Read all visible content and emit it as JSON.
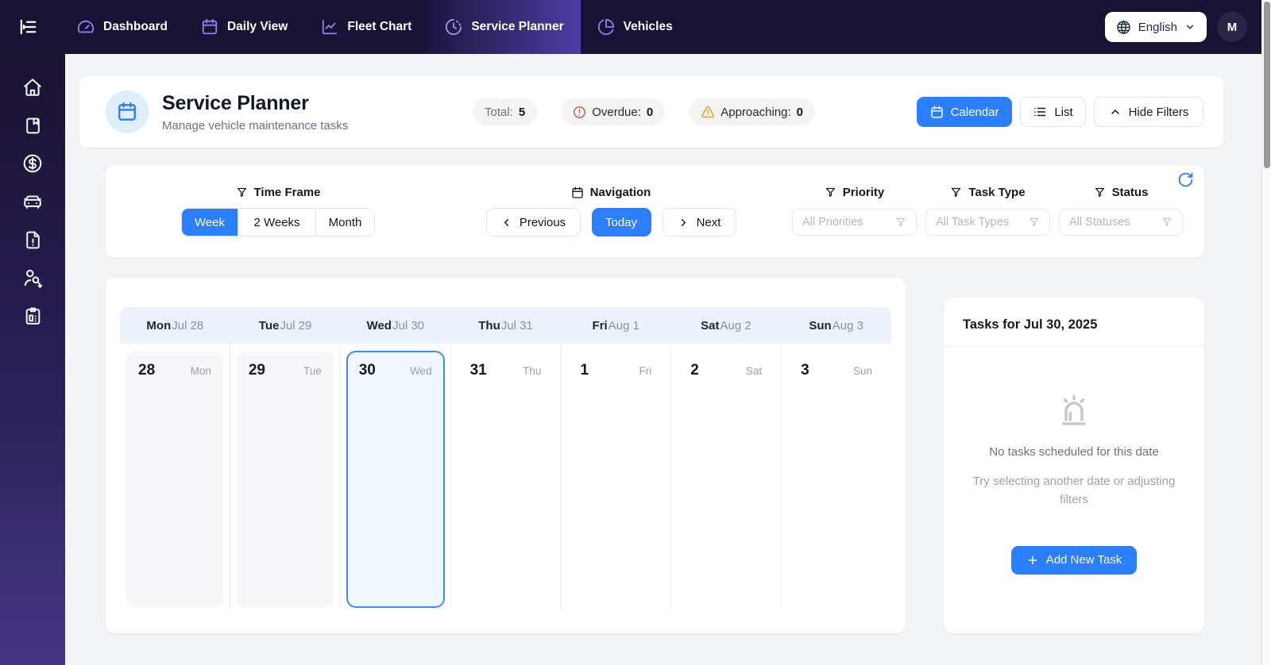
{
  "navbar": {
    "items": [
      {
        "label": "Dashboard",
        "icon": "gauge-icon",
        "active": false
      },
      {
        "label": "Daily View",
        "icon": "calendar-icon",
        "active": false
      },
      {
        "label": "Fleet Chart",
        "icon": "line-chart-icon",
        "active": false
      },
      {
        "label": "Service Planner",
        "icon": "clock-fading-icon",
        "active": true
      },
      {
        "label": "Vehicles",
        "icon": "pie-chart-icon",
        "active": false
      }
    ],
    "language": {
      "label": "English",
      "icon": "globe-icon"
    },
    "avatar": "M"
  },
  "sidebar": {
    "icons": [
      "home-icon",
      "bookmark-icon",
      "dollar-circle-icon",
      "car-icon",
      "file-alert-icon",
      "user-search-icon",
      "clipboard-icon"
    ]
  },
  "header": {
    "title": "Service Planner",
    "subtitle": "Manage vehicle maintenance tasks",
    "stats": [
      {
        "label": "Total:",
        "value": "5"
      },
      {
        "label": "Overdue:",
        "value": "0",
        "icon": "alert-circle-icon"
      },
      {
        "label": "Approaching:",
        "value": "0",
        "icon": "warning-triangle-icon"
      }
    ],
    "buttons": {
      "calendar": "Calendar",
      "list": "List",
      "hide_filters": "Hide Filters"
    }
  },
  "filters": {
    "time_frame": {
      "label": "Time Frame",
      "options": [
        "Week",
        "2 Weeks",
        "Month"
      ],
      "selected": "Week"
    },
    "navigation": {
      "label": "Navigation",
      "previous": "Previous",
      "today": "Today",
      "next": "Next"
    },
    "priority": {
      "label": "Priority",
      "placeholder": "All Priorities"
    },
    "task_type": {
      "label": "Task Type",
      "placeholder": "All Task Types"
    },
    "status": {
      "label": "Status",
      "placeholder": "All Statuses"
    }
  },
  "calendar": {
    "days": [
      {
        "name": "Mon",
        "date": "Jul 28",
        "num": "28",
        "state": "past"
      },
      {
        "name": "Tue",
        "date": "Jul 29",
        "num": "29",
        "state": "past"
      },
      {
        "name": "Wed",
        "date": "Jul 30",
        "num": "30",
        "state": "selected"
      },
      {
        "name": "Thu",
        "date": "Jul 31",
        "num": "31",
        "state": "future"
      },
      {
        "name": "Fri",
        "date": "Aug 1",
        "num": "1",
        "state": "future"
      },
      {
        "name": "Sat",
        "date": "Aug 2",
        "num": "2",
        "state": "future"
      },
      {
        "name": "Sun",
        "date": "Aug 3",
        "num": "3",
        "state": "future"
      }
    ],
    "selected_index": 2
  },
  "tasks_panel": {
    "title": "Tasks for Jul 30, 2025",
    "empty_title": "No tasks scheduled for this date",
    "empty_hint": "Try selecting another date or adjusting filters",
    "add_button": "Add New Task"
  },
  "colors": {
    "accent_blue": "#2b7fff",
    "danger_red": "#ef4444",
    "warning_amber": "#f59e0b",
    "navbar_bg": "#181334",
    "nav_icon_purple": "#9181e8",
    "selected_day_border": "#3d8bff"
  }
}
